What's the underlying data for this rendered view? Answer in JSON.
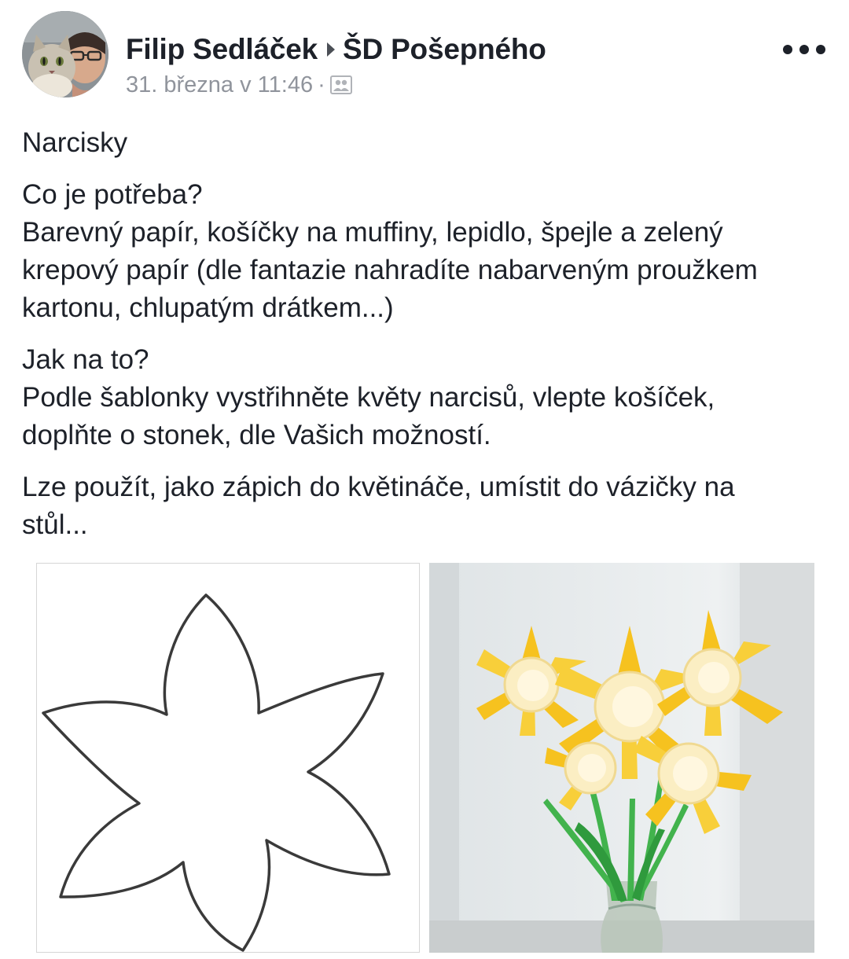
{
  "post": {
    "author": "Filip Sedláček",
    "group": "ŠD Pošepného",
    "timestamp": "31. března v 11:46",
    "separator": "·",
    "audience_icon": "group-audience-icon",
    "more_icon": "more-options-icon",
    "paragraphs": [
      {
        "lines": [
          "Narcisky"
        ]
      },
      {
        "lines": [
          "Co je potřeba?",
          "Barevný papír, košíčky na muffiny, lepidlo, špejle a zelený",
          "krepový papír (dle fantazie nahradíte nabarveným proužkem",
          "kartonu, chlupatým drátkem...)"
        ]
      },
      {
        "lines": [
          "Jak na to?",
          "Podle šablonky vystřihněte květy narcisů, vlepte košíček,",
          "doplňte o stonek, dle Vašich možností."
        ]
      },
      {
        "lines": [
          "Lze použít, jako zápich do květináče, umístit do vázičky na",
          "stůl..."
        ]
      }
    ]
  },
  "photos": [
    {
      "name": "daffodil-template-outline"
    },
    {
      "name": "paper-daffodils-in-vase"
    }
  ],
  "colors": {
    "text": "#1d2129",
    "meta": "#90949c",
    "daffodil_yellow": "#f7c72a",
    "cup_cream": "#fbeec3",
    "stem_green": "#3bb54a"
  }
}
